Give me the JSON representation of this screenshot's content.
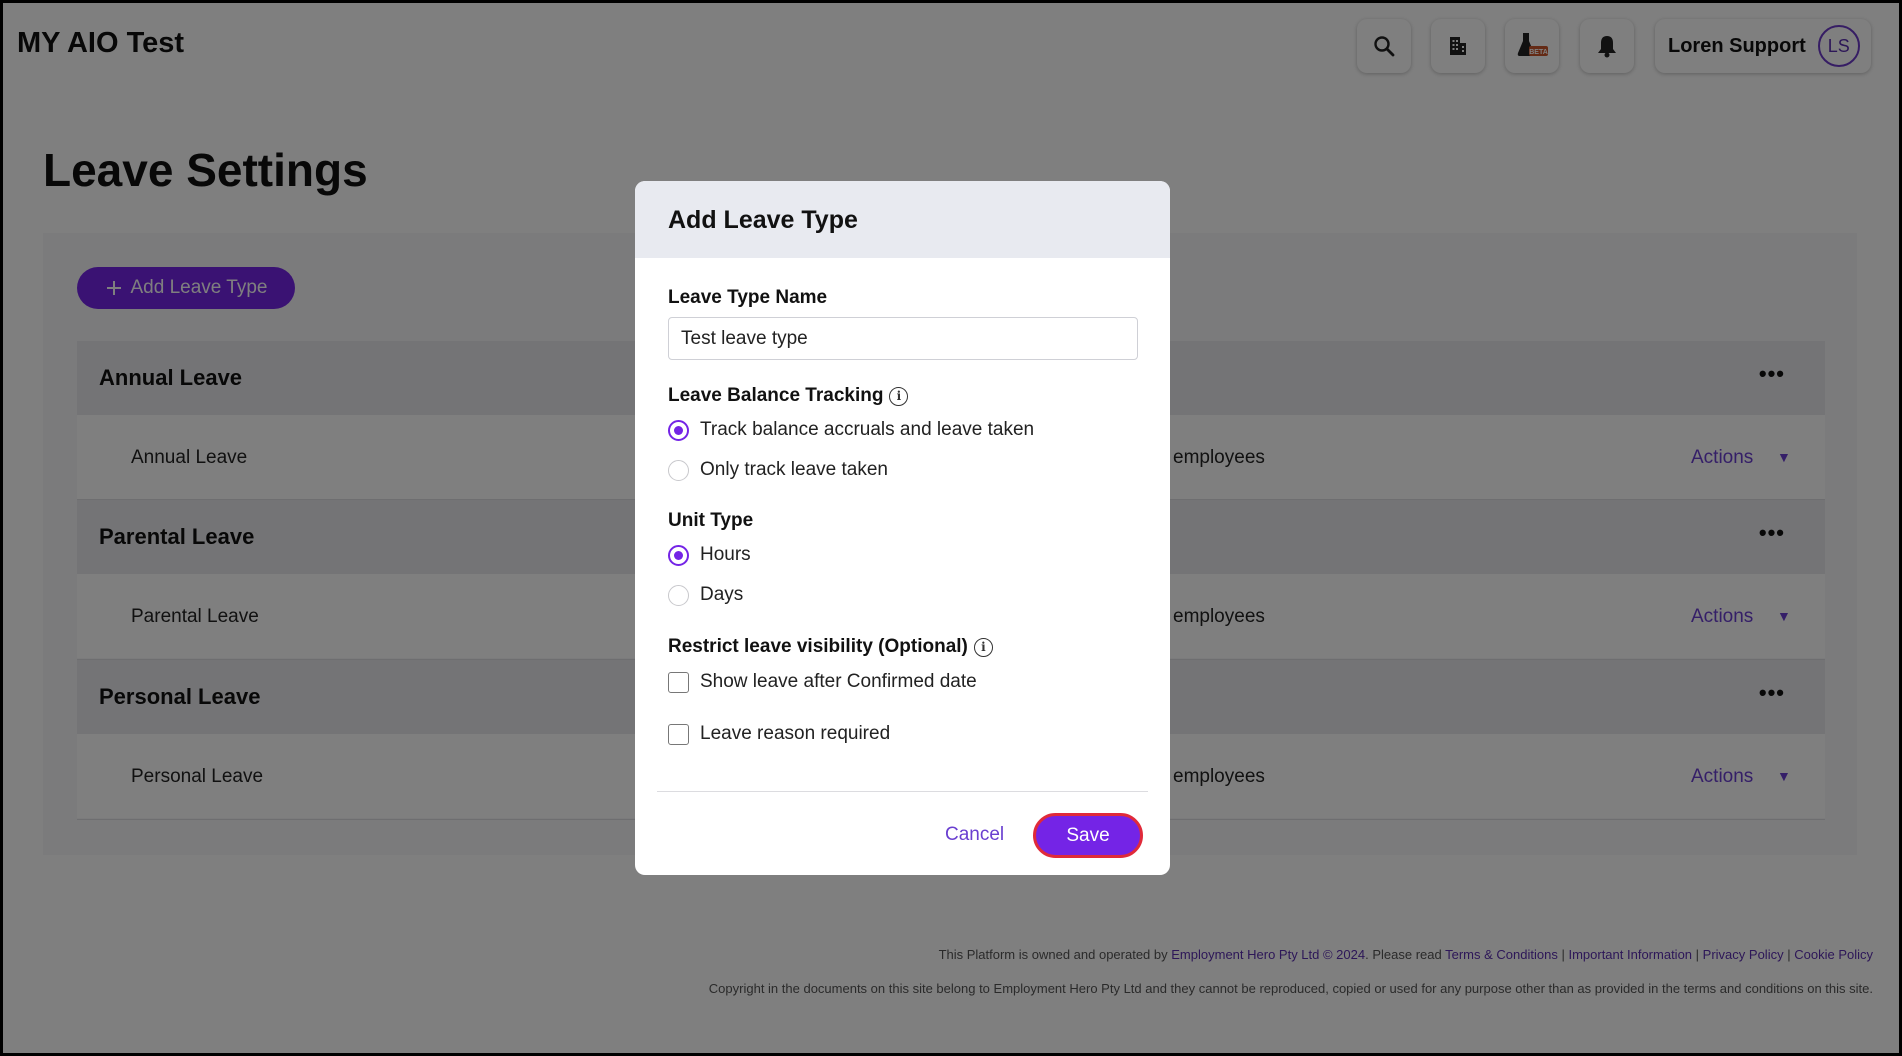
{
  "header": {
    "app_title": "MY AIO Test",
    "icons": [
      "search-icon",
      "building-icon",
      "beta-flask-icon",
      "bell-icon"
    ],
    "beta_badge": "BETA",
    "user_name": "Loren Support",
    "user_initials": "LS"
  },
  "page": {
    "title": "Leave Settings",
    "add_button_label": "Add Leave Type",
    "groups": [
      {
        "title": "Annual Leave",
        "row": {
          "name": "Annual Leave",
          "employees": "employees",
          "actions": "Actions"
        }
      },
      {
        "title": "Parental Leave",
        "row": {
          "name": "Parental Leave",
          "employees": "employees",
          "actions": "Actions"
        }
      },
      {
        "title": "Personal Leave",
        "row": {
          "name": "Personal Leave",
          "employees": "employees",
          "actions": "Actions"
        }
      }
    ],
    "more_label": "•••",
    "caret": "▼"
  },
  "modal": {
    "title": "Add Leave Type",
    "name_label": "Leave Type Name",
    "name_value": "Test leave type",
    "tracking_label": "Leave Balance Tracking",
    "tracking_options": [
      "Track balance accruals and leave taken",
      "Only track leave taken"
    ],
    "tracking_selected": "Track balance accruals and leave taken",
    "unit_label": "Unit Type",
    "unit_options": [
      "Hours",
      "Days"
    ],
    "unit_selected": "Hours",
    "visibility_label": "Restrict leave visibility (Optional)",
    "checkboxes": [
      "Show leave after Confirmed date",
      "Leave reason required"
    ],
    "cancel_label": "Cancel",
    "save_label": "Save"
  },
  "footer": {
    "line1_prefix": "This Platform is owned and operated by",
    "company": "Employment Hero Pty Ltd © 2024",
    "please_read": ". Please read",
    "links": [
      "Terms & Conditions",
      "Important Information",
      "Privacy Policy",
      "Cookie Policy"
    ],
    "separator": "|",
    "line2": "Copyright in the documents on this site belong to Employment Hero Pty Ltd and they cannot be reproduced, copied or used for any purpose other than as provided in the terms and conditions on this site."
  },
  "colors": {
    "accent": "#7424e6",
    "save_outline": "#e02a3a",
    "link": "#6a3fd0"
  }
}
